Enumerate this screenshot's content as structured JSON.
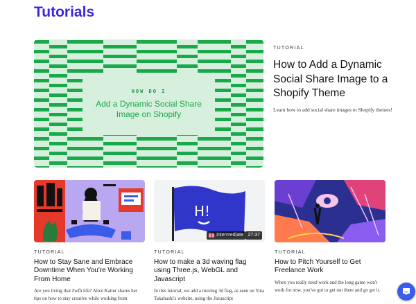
{
  "header": {
    "title": "Tutorials"
  },
  "featured": {
    "image_kicker": "HOW DO I",
    "image_title": "Add a Dynamic Social Share Image on Shopify",
    "kicker": "TUTORIAL",
    "title": "How to Add a Dynamic Social Share Image to a Shopify Theme",
    "description": "Learn how to add social share images to Shopify themes!"
  },
  "cards": [
    {
      "kicker": "TUTORIAL",
      "title": "How to Stay Sane and Embrace Downtime When You're Working From Home",
      "description": "Are you living that #wfh life? Alice Katter shares her tips on how to stay creative while working from"
    },
    {
      "kicker": "TUTORIAL",
      "title": "How to make a 3d waving flag using Three.js, WebGL and Javascript",
      "description": "In this tutorial, we add a moving 3d flag, as seen on Yuta Takahashi's website, using the Javascript",
      "level": "Intermediate",
      "duration": "27:37",
      "image_text": "H!"
    },
    {
      "kicker": "TUTORIAL",
      "title": "How to Pitch Yourself to Get Freelance Work",
      "description": "When you really need work and the long game won't work for now, you've got to get out there and go get it."
    }
  ],
  "icons": {
    "chat": "chat-bubble-icon",
    "level": "signal-bars-icon"
  },
  "colors": {
    "accent": "#3b24e0",
    "feature_green": "#1aa94a",
    "chat": "#3b5ce8"
  }
}
